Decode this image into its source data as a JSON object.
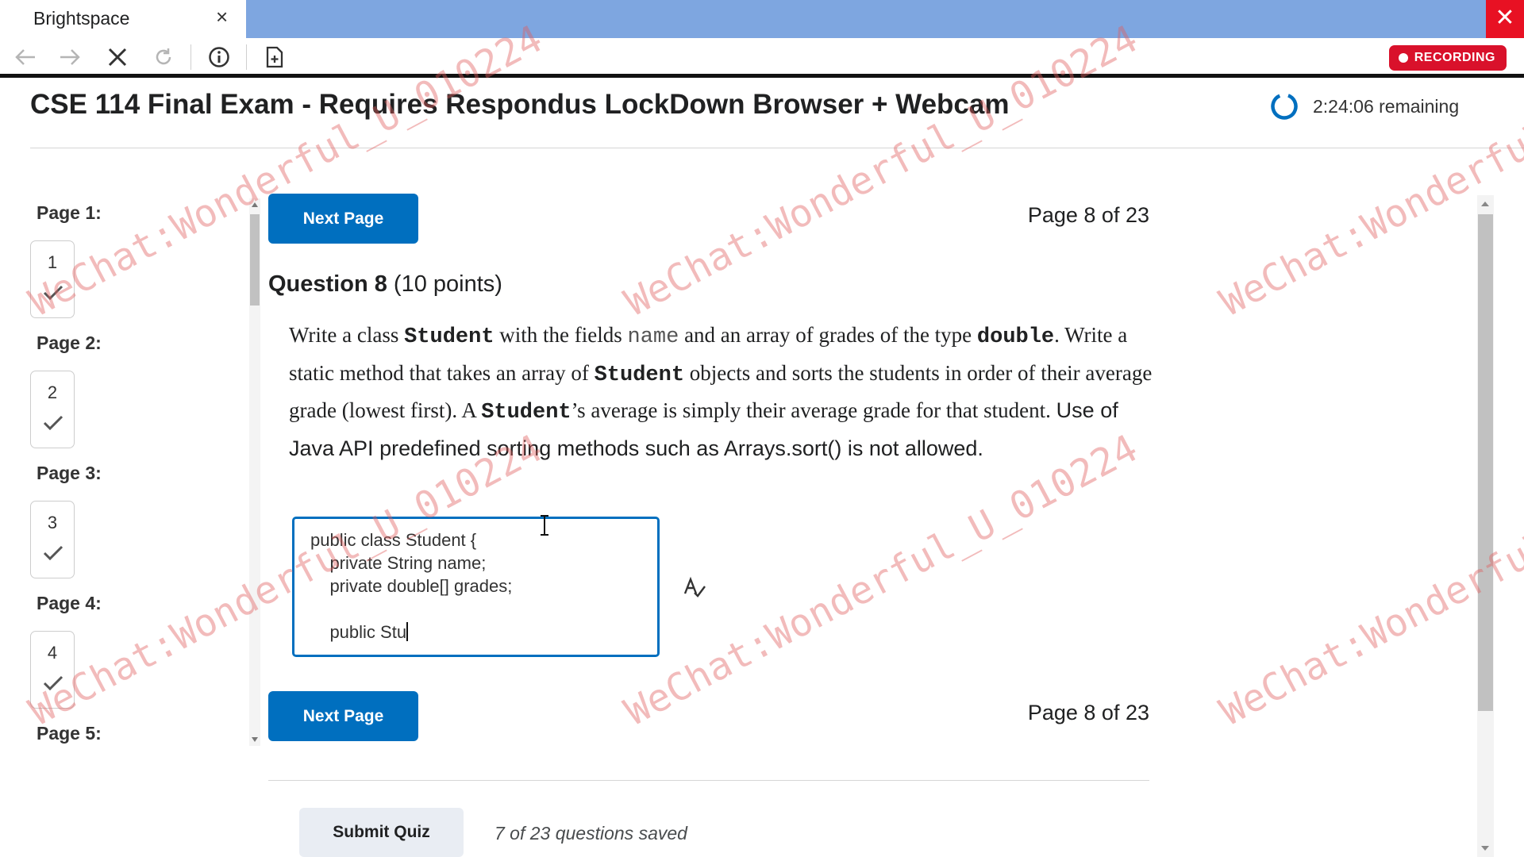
{
  "browser": {
    "tab_title": "Brightspace",
    "tab_close": "×",
    "window_close": "✕",
    "recording_label": "RECORDING"
  },
  "header": {
    "exam_title": "CSE 114 Final Exam - Requires Respondus LockDown Browser + Webcam",
    "time_remaining": "2:24:06 remaining"
  },
  "nav": {
    "pages": [
      {
        "label": "Page 1:",
        "number": "1",
        "answered": true
      },
      {
        "label": "Page 2:",
        "number": "2",
        "answered": true
      },
      {
        "label": "Page 3:",
        "number": "3",
        "answered": true
      },
      {
        "label": "Page 4:",
        "number": "4",
        "answered": true
      },
      {
        "label": "Page 5:"
      }
    ]
  },
  "main": {
    "next_page_label": "Next Page",
    "page_indicator": "Page 8 of 23",
    "question_title": "Question 8",
    "question_points": "(10 points)",
    "question_text": {
      "t1": "Write a class ",
      "c1": "Student",
      "t2": " with the fields ",
      "c2": "name",
      "t3": " and an array of grades of the type ",
      "c3": "double",
      "t4": ". Write a static method that takes an array of ",
      "c4": "Student",
      "t5": " objects and sorts the students in order of their average grade (lowest first). A ",
      "c5": "Student",
      "t6": "’s average is simply their average grade for that student. ",
      "s1": "Use of Java API predefined sorting methods such as Arrays.sort() is not allowed."
    },
    "answer_text": "public class Student {\n    private String name;\n    private double[] grades;\n\n    public Stu",
    "submit_label": "Submit Quiz",
    "saved_status": "7 of 23 questions saved"
  },
  "watermark": "WeChat:Wonderful_U_010224",
  "colors": {
    "accent": "#006fbf",
    "recording": "#d9112b",
    "titlebar": "#7ea6e0",
    "close": "#e81123",
    "watermark": "#e05c5c"
  }
}
